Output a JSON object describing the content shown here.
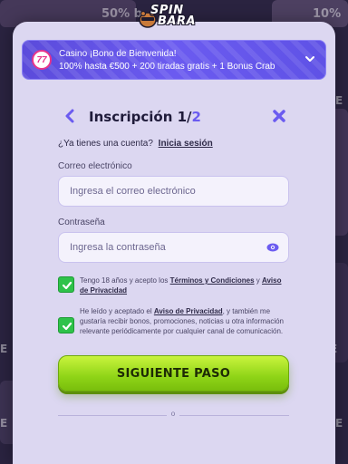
{
  "logo": {
    "line1": "SPIN",
    "line2": "BARA"
  },
  "background": {
    "tile_text_1": "50% b",
    "tile_text_2": "10% k",
    "side_text": "E"
  },
  "banner": {
    "title": "Casino ¡Bono de Bienvenida!",
    "subtitle": "100% hasta €500 + 200 tiradas gratis + 1 Bonus Crab",
    "badge": "7"
  },
  "form": {
    "title": "Inscripción 1/",
    "step_total": "2",
    "login_prompt": "¿Ya tienes una cuenta?",
    "login_link": "Inicia sesión",
    "email_label": "Correo electrónico",
    "email_placeholder": "Ingresa el correo electrónico",
    "password_label": "Contraseña",
    "password_placeholder": "Ingresa la contraseña",
    "consent_1_pre": "Tengo 18 años y acepto los ",
    "consent_1_terms": "Términos y Condiciones",
    "consent_1_mid": " y ",
    "consent_1_privacy": "Aviso de Privacidad",
    "consent_2_pre": "He leído y aceptado el ",
    "consent_2_privacy": "Aviso de Privacidad",
    "consent_2_post": ", y también me gustaría recibir bonos, promociones, noticias u otra información relevante periódicamente por cualquier canal de comunicación.",
    "next_button": "SIGUIENTE PASO",
    "divider_text": "o"
  },
  "colors": {
    "accent": "#6b5bf0",
    "checkbox": "#2ec24a",
    "cta": "#8fd417",
    "modal_bg": "#dcd7f1"
  }
}
